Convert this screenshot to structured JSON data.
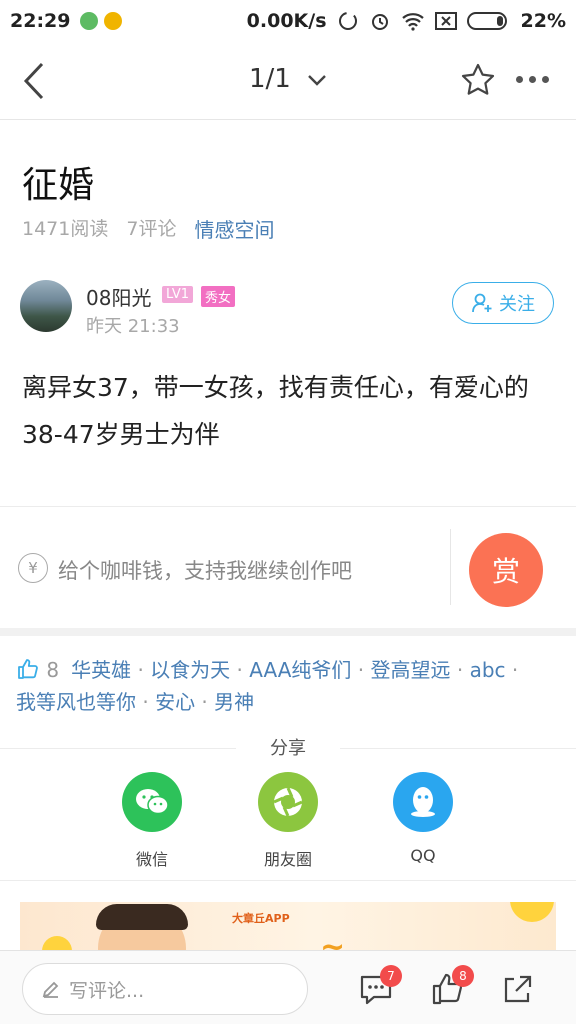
{
  "status_bar": {
    "time": "22:29",
    "network_speed": "0.00K/s",
    "battery": "22%"
  },
  "nav": {
    "page_indicator": "1/1"
  },
  "article": {
    "title": "征婚",
    "reads": "1471阅读",
    "comments": "7评论",
    "category": "情感空间",
    "author": {
      "name": "08阳光",
      "level": "LV1",
      "tag": "秀女",
      "time": "昨天 21:33",
      "follow_label": "关注"
    },
    "body": "离异女37，带一女孩，找有责任心，有爱心的38-47岁男士为伴"
  },
  "reward": {
    "icon_symbol": "¥",
    "text": "给个咖啡钱，支持我继续创作吧",
    "button_label": "赏"
  },
  "likes": {
    "count": "8",
    "users": [
      "华英雄",
      "以食为天",
      "AAA纯爷们",
      "登高望远",
      "abc",
      "我等风也等你",
      "安心",
      "男神"
    ]
  },
  "share": {
    "title": "分享",
    "items": [
      {
        "label": "微信",
        "icon": "wechat-icon",
        "color": "#2dc25a"
      },
      {
        "label": "朋友圈",
        "icon": "moments-icon",
        "color": "#8cc63f"
      },
      {
        "label": "QQ",
        "icon": "qq-icon",
        "color": "#2aa6ef"
      }
    ]
  },
  "banner": {
    "brand": "大章丘APP"
  },
  "bottom_bar": {
    "comment_placeholder": "写评论...",
    "comment_badge": "7",
    "like_badge": "8"
  },
  "colors": {
    "accent": "#3aaee8",
    "link": "#4a7fb5",
    "reward": "#fb7254",
    "badge": "#f24b4b"
  }
}
